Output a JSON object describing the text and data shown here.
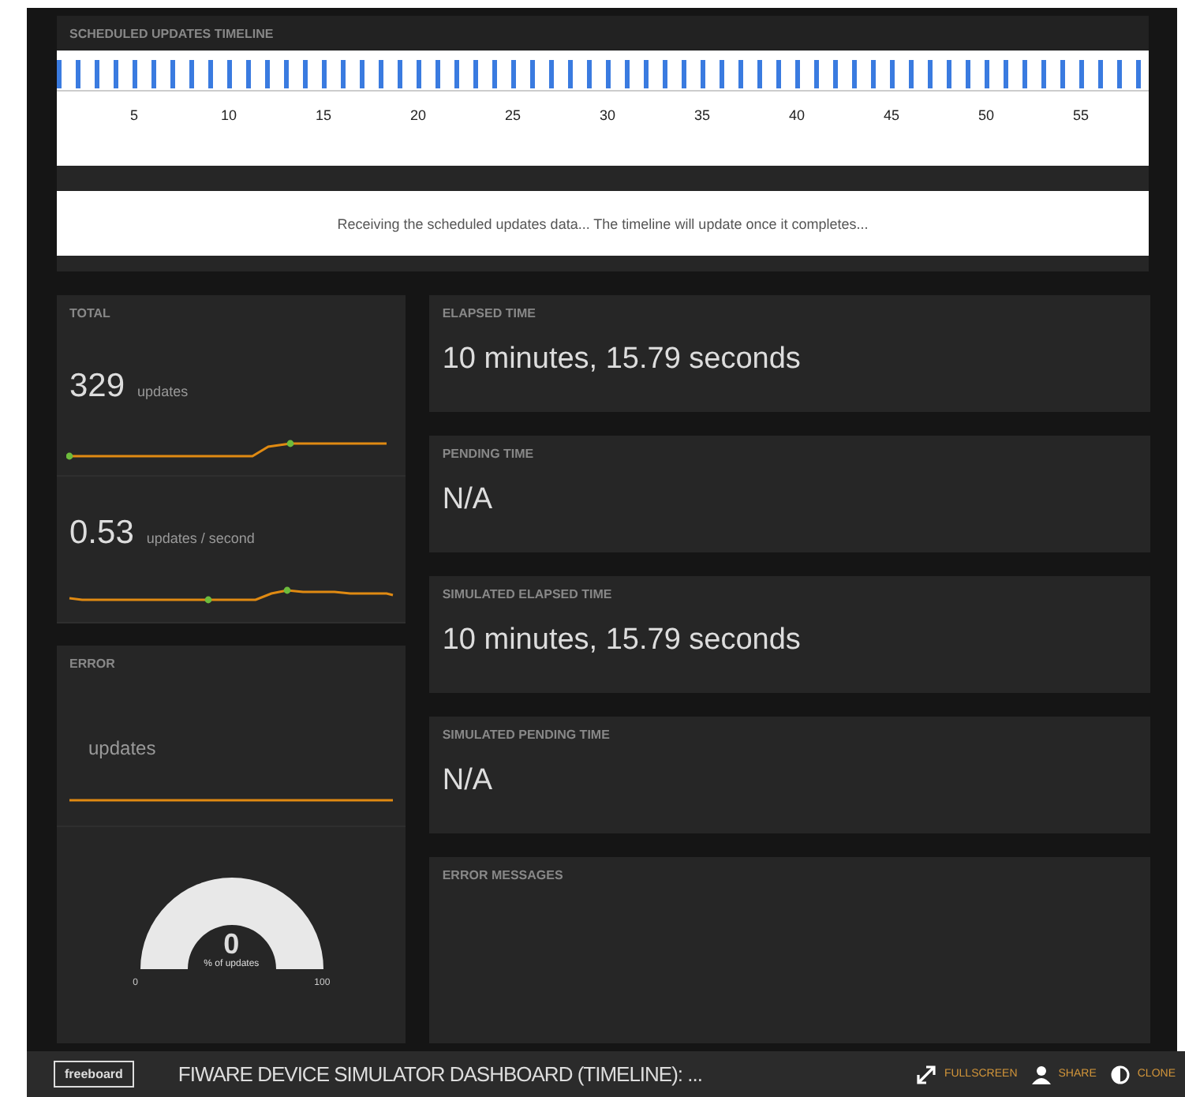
{
  "timeline": {
    "title": "SCHEDULED UPDATES TIMELINE",
    "axis_labels": [
      "5",
      "10",
      "15",
      "20",
      "25",
      "30",
      "35",
      "40",
      "45",
      "50",
      "55"
    ],
    "message": "Receiving the scheduled updates data... The timeline will update once it completes..."
  },
  "left_panels": [
    {
      "kind": "total",
      "title": "TOTAL",
      "metrics": [
        {
          "value": "329",
          "unit": "updates"
        },
        {
          "value": "0.53",
          "unit": "updates / second"
        }
      ]
    },
    {
      "kind": "error",
      "title": "ERROR",
      "metrics": [
        {
          "unit": "updates"
        }
      ],
      "gauge": {
        "value": "0",
        "caption": "% of updates",
        "min": "0",
        "max": "100"
      }
    }
  ],
  "right_panels": [
    {
      "title": "ELAPSED TIME",
      "value": "10 minutes, 15.79 seconds"
    },
    {
      "title": "PENDING TIME",
      "value": "N/A"
    },
    {
      "title": "SIMULATED ELAPSED TIME",
      "value": "10 minutes, 15.79 seconds"
    },
    {
      "title": "SIMULATED PENDING TIME",
      "value": "N/A"
    },
    {
      "kind": "messages",
      "title": "ERROR MESSAGES"
    }
  ],
  "footer": {
    "logo": "freeboard",
    "title": "FIWARE DEVICE SIMULATOR DASHBOARD (TIMELINE): ...",
    "actions": [
      {
        "kind": "fullscreen",
        "label": "FULLSCREEN"
      },
      {
        "kind": "share",
        "label": "SHARE"
      },
      {
        "kind": "clone",
        "label": "CLONE"
      }
    ]
  }
}
